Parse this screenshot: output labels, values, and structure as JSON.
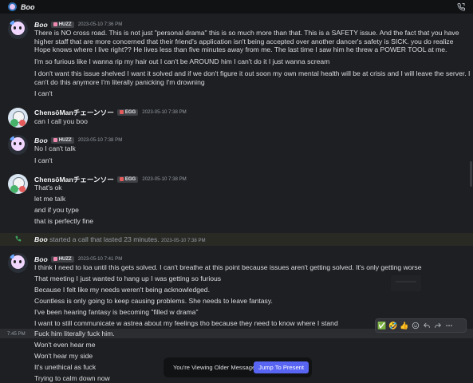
{
  "window": {
    "title": "Boo"
  },
  "roles": {
    "huzz": "HUZZ",
    "egg": "EGG"
  },
  "messages": [
    {
      "author": "Boo",
      "timestamp": "2023-05-10 7:36 PM",
      "lines": [
        "There is NO cross road. This is not just \"personal drama\" this is so much more than that. This is a SAFETY issue. And the fact that you have higher staff that are more concerned that their friend's application isn't being accepted over another dancer's safety is SICK. you do realize Hope knows where I live right?? He lives less than five minutes away from me. The last time I saw him he threw a POWER TOOL at me.",
        "I'm so furious like I wanna rip my hair out I can't be AROUND him I can't do it I just wanna scream",
        "I don't want this issue shelved I want it solved and if we don't figure it out soon my own mental health will be at crisis and I will leave the server. I can't do this anymore I'm literally panicking I'm drowning",
        "I can't"
      ]
    },
    {
      "author": "ChensōManチェーンソー",
      "timestamp": "2023-05-10 7:38 PM",
      "lines": [
        "can I call you boo"
      ]
    },
    {
      "author": "Boo",
      "timestamp": "2023-05-10 7:38 PM",
      "lines": [
        "No I can't talk",
        "I can't"
      ]
    },
    {
      "author": "ChensōManチェーンソー",
      "timestamp": "2023-05-10 7:38 PM",
      "lines": [
        "That's ok",
        "let me talk",
        "and if you type",
        "that is perfectly fine"
      ]
    },
    {
      "author": "Boo",
      "timestamp": "2023-05-10 7:41 PM",
      "lines": [
        "I think I need to loa until this gets solved. I can't breathe at this point because issues aren't getting solved. It's only getting worse",
        "That meeting I just wanted to hang up I was getting so furious",
        "Because I felt like my needs weren't being acknowledged.",
        "Countless is only going to keep causing problems. She needs to leave fantasy.",
        "I've been hearing fantasy is becoming \"filled w drama\"",
        "I want to still communicate w astrea about my feelings tho because they need to know where I stand",
        "Fuck him literally fuck him.",
        "Won't even hear me",
        "Won't hear my side",
        "It's unethical as fuck",
        "Trying to calm down now"
      ]
    }
  ],
  "system": {
    "author": "Boo",
    "text": " started a call that lasted 23 minutes.",
    "timestamp": "2023-05-10 7:38 PM"
  },
  "hover": {
    "time": "7:45 PM"
  },
  "reactions": [
    "✅",
    "🤣",
    "👍"
  ],
  "banner": {
    "text": "You're Viewing Older Messages",
    "button": "Jump To Present"
  },
  "colors": {
    "accent": "#5865f2",
    "background": "#1e1f22",
    "topbar": "#111214"
  }
}
